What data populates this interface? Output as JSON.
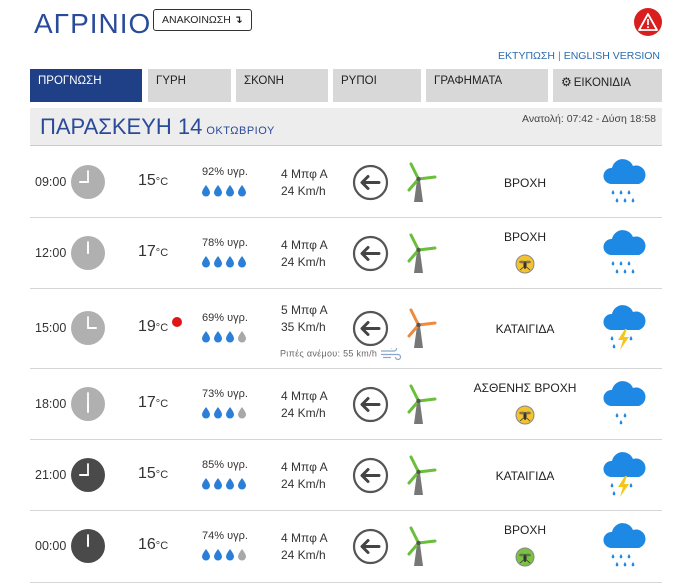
{
  "header": {
    "city": "ΑΓΡΙΝΙΟ",
    "announce_label": "ΑΝΑΚΟΙΝΩΣΗ",
    "announce_arrow": "↴",
    "alert_icon": "warning-triangle-icon",
    "print_link": "ΕΚΤΥΠΩΣΗ",
    "separator": "|",
    "english_link": "ENGLISH VERSION"
  },
  "tabs": [
    {
      "label": "ΠΡΟΓΝΩΣΗ",
      "active": true
    },
    {
      "label": "ΓΥΡΗ",
      "active": false
    },
    {
      "label": "ΣΚΟΝΗ",
      "active": false
    },
    {
      "label": "ΡΥΠΟΙ",
      "active": false
    },
    {
      "label": "ΓΡΑΦΗΜΑΤΑ",
      "active": false
    },
    {
      "label": "ΕΙΚΟΝΙΔΙΑ",
      "active": false,
      "icon": "gear-icon"
    }
  ],
  "day": {
    "name": "ΠΑΡΑΣΚΕΥΗ 14",
    "month": "ΟΚΤΩΒΡΙΟΥ",
    "sun": "Ανατολή: 07:42  - Δύση 18:58"
  },
  "colors": {
    "brand": "#2a4a9a",
    "tab_active": "#1f3f86",
    "alert": "#d81e1e",
    "turbine_green": "#6abf3a",
    "turbine_orange": "#ef8a3c",
    "cloud": "#1e88e5",
    "bolt": "#f5c518",
    "mosquito_yellow": "#f2c230",
    "mosquito_green": "#7cc242"
  },
  "rows": [
    {
      "time": "09:00",
      "clock_hour": 9,
      "night": false,
      "temp": "15",
      "temp_unit": "°C",
      "hot": false,
      "humidity": "92% υγρ.",
      "drops_full": 4,
      "beaufort": "4 Μπφ Α",
      "speed": "24 Km/h",
      "gust": null,
      "turbine": "green",
      "condition": "ΒΡΟΧΗ",
      "mosquito": null,
      "weather_icon": "rain"
    },
    {
      "time": "12:00",
      "clock_hour": 12,
      "night": false,
      "temp": "17",
      "temp_unit": "°C",
      "hot": false,
      "humidity": "78% υγρ.",
      "drops_full": 4,
      "beaufort": "4 Μπφ Α",
      "speed": "24 Km/h",
      "gust": null,
      "turbine": "green",
      "condition": "ΒΡΟΧΗ",
      "mosquito": "yellow",
      "weather_icon": "rain"
    },
    {
      "time": "15:00",
      "clock_hour": 3,
      "night": false,
      "temp": "19",
      "temp_unit": "°C",
      "hot": true,
      "humidity": "69% υγρ.",
      "drops_full": 3,
      "beaufort": "5 Μπφ Α",
      "speed": "35 Km/h",
      "gust": "Ριπές ανέμου: 55 km/h",
      "turbine": "orange",
      "condition": "ΚΑΤΑΙΓΙΔΑ",
      "mosquito": null,
      "weather_icon": "storm"
    },
    {
      "time": "18:00",
      "clock_hour": 6,
      "night": false,
      "temp": "17",
      "temp_unit": "°C",
      "hot": false,
      "humidity": "73% υγρ.",
      "drops_full": 3,
      "beaufort": "4 Μπφ Α",
      "speed": "24 Km/h",
      "gust": null,
      "turbine": "green",
      "condition": "ΑΣΘΕΝΗΣ ΒΡΟΧΗ",
      "mosquito": "yellow",
      "weather_icon": "light-rain"
    },
    {
      "time": "21:00",
      "clock_hour": 9,
      "night": true,
      "temp": "15",
      "temp_unit": "°C",
      "hot": false,
      "humidity": "85% υγρ.",
      "drops_full": 4,
      "beaufort": "4 Μπφ Α",
      "speed": "24 Km/h",
      "gust": null,
      "turbine": "green",
      "condition": "ΚΑΤΑΙΓΙΔΑ",
      "mosquito": null,
      "weather_icon": "storm"
    },
    {
      "time": "00:00",
      "clock_hour": 12,
      "night": true,
      "temp": "16",
      "temp_unit": "°C",
      "hot": false,
      "humidity": "74% υγρ.",
      "drops_full": 3,
      "beaufort": "4 Μπφ Α",
      "speed": "24 Km/h",
      "gust": null,
      "turbine": "green",
      "condition": "ΒΡΟΧΗ",
      "mosquito": "green",
      "weather_icon": "rain"
    }
  ]
}
